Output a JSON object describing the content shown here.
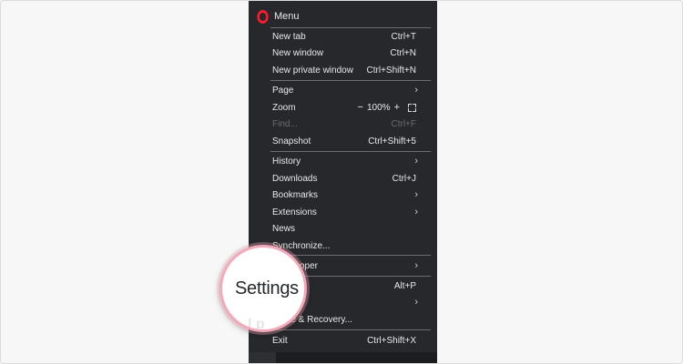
{
  "menu": {
    "title": "Menu",
    "items": [
      {
        "label": "New tab",
        "shortcut": "Ctrl+T"
      },
      {
        "label": "New window",
        "shortcut": "Ctrl+N"
      },
      {
        "label": "New private window",
        "shortcut": "Ctrl+Shift+N"
      },
      {
        "label": "Page",
        "shortcut": ""
      },
      {
        "label": "Zoom",
        "shortcut": ""
      },
      {
        "label": "Find...",
        "shortcut": "Ctrl+F"
      },
      {
        "label": "Snapshot",
        "shortcut": "Ctrl+Shift+5"
      },
      {
        "label": "History",
        "shortcut": ""
      },
      {
        "label": "Downloads",
        "shortcut": "Ctrl+J"
      },
      {
        "label": "Bookmarks",
        "shortcut": ""
      },
      {
        "label": "Extensions",
        "shortcut": ""
      },
      {
        "label": "News",
        "shortcut": ""
      },
      {
        "label": "Synchronize...",
        "shortcut": ""
      },
      {
        "label": "oper",
        "shortcut": ""
      },
      {
        "label": "",
        "shortcut": "Alt+P"
      },
      {
        "label": "",
        "shortcut": ""
      },
      {
        "label": "ate & Recovery...",
        "shortcut": ""
      },
      {
        "label": "Exit",
        "shortcut": "Ctrl+Shift+X"
      }
    ],
    "zoom": {
      "minus": "−",
      "level": "100%",
      "plus": "+"
    }
  },
  "magnifier": {
    "label": "Settings",
    "ghost_text": "l p"
  },
  "colors": {
    "menu_bg": "#26282b",
    "text": "#e8e8e8",
    "disabled": "#6a6c70",
    "opera_red": "#ff1b2d",
    "magnifier_ring": "#f2a9b9"
  }
}
